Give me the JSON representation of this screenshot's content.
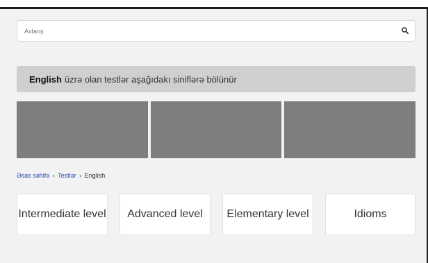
{
  "search": {
    "placeholder": "Axtanş",
    "icon": "search-icon"
  },
  "banner": {
    "bold_text": "English",
    "text": "üzrə olan testlər aşağıdakı siniflərə bölünür"
  },
  "breadcrumb": {
    "items": [
      "Əsas səhifə",
      "Testlər",
      "English"
    ],
    "separator": "›"
  },
  "levels": [
    {
      "label": "Intermediate level"
    },
    {
      "label": "Advanced level"
    },
    {
      "label": "Elementary level"
    },
    {
      "label": "Idioms"
    }
  ],
  "colors": {
    "background": "#f2f2f2",
    "banner": "#cfcfcf",
    "tile": "#7e7e7e",
    "link": "#2a4db5"
  }
}
